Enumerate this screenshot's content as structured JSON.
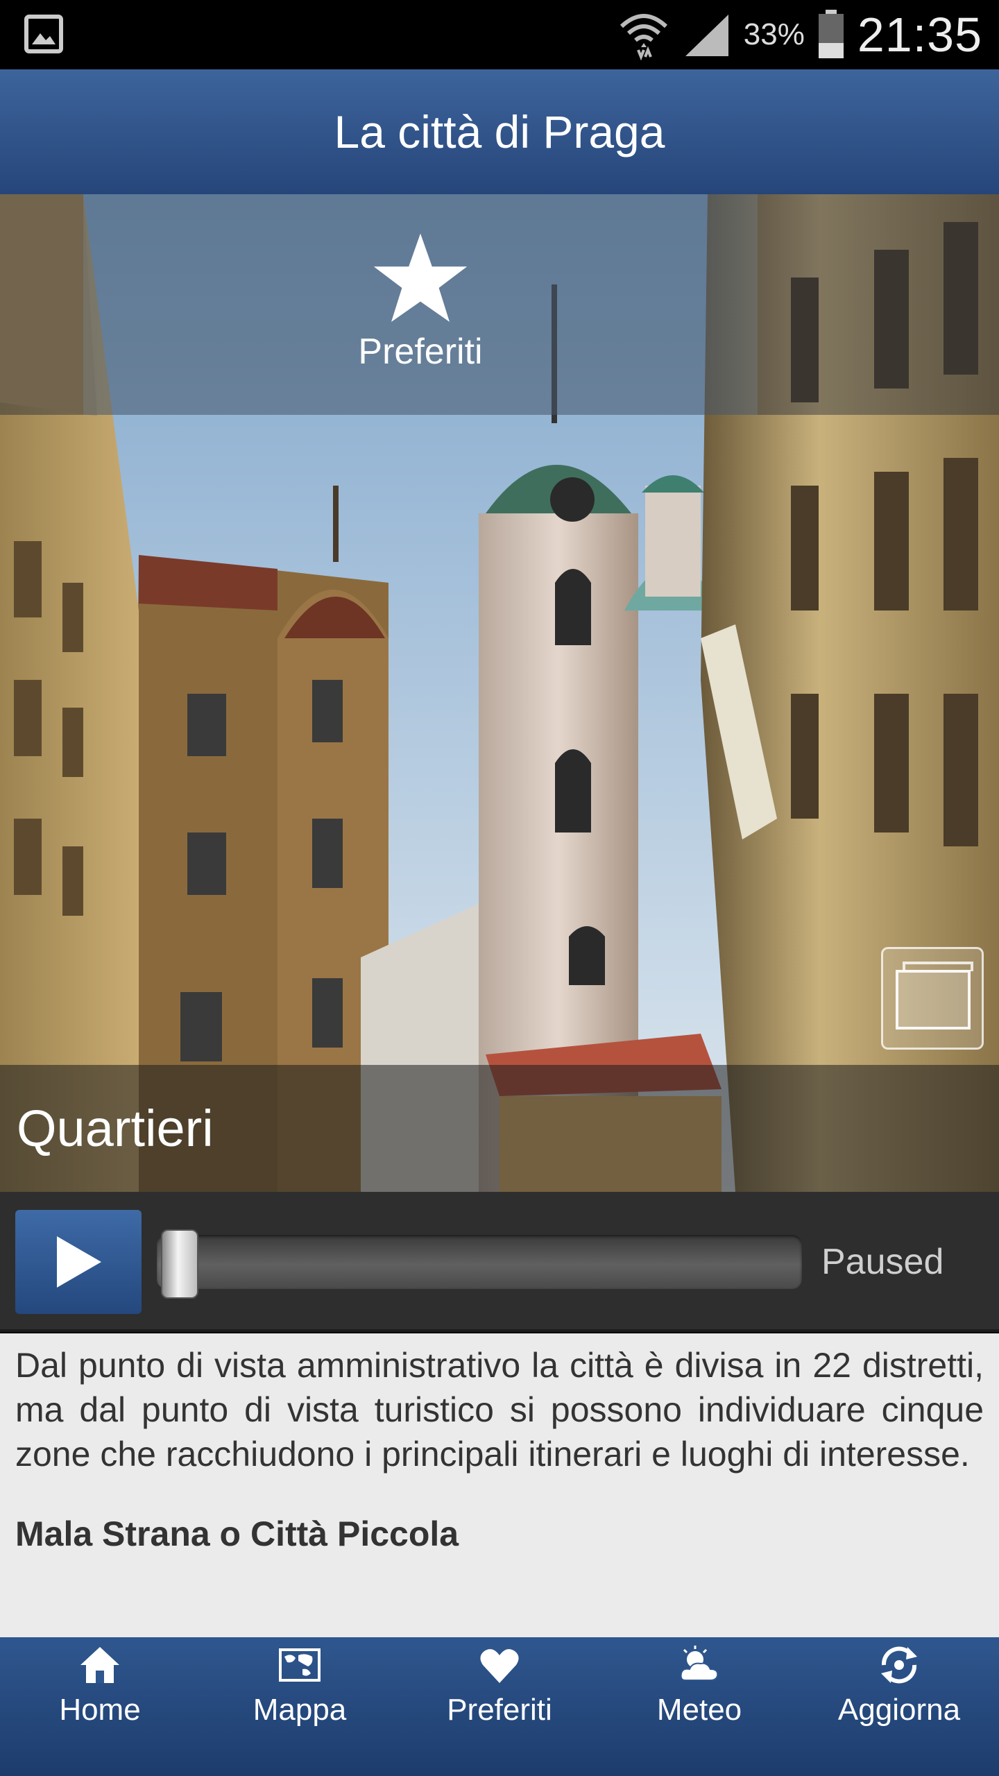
{
  "status_bar": {
    "battery_percent": "33%",
    "time": "21:35"
  },
  "header": {
    "title": "La città di Praga"
  },
  "favorites_overlay": {
    "label": "Preferiti"
  },
  "section": {
    "title": "Quartieri"
  },
  "player": {
    "status": "Paused",
    "progress": 0.0
  },
  "content": {
    "paragraph": "Dal punto di vista amministrativo la città è divisa in 22 distretti, ma dal punto di vista turistico si possono individuare cinque zone che racchiudono i principali itinerari e luoghi di interesse.",
    "heading": "Mala Strana o Città Piccola"
  },
  "bottom_nav": {
    "items": [
      {
        "label": "Home",
        "icon": "home-icon"
      },
      {
        "label": "Mappa",
        "icon": "map-icon"
      },
      {
        "label": "Preferiti",
        "icon": "heart-icon"
      },
      {
        "label": "Meteo",
        "icon": "weather-icon"
      },
      {
        "label": "Aggiorna",
        "icon": "refresh-icon"
      }
    ]
  },
  "colors": {
    "header_blue": "#2f578f",
    "player_bg": "#2e2e2e",
    "content_bg": "#ebebeb"
  }
}
